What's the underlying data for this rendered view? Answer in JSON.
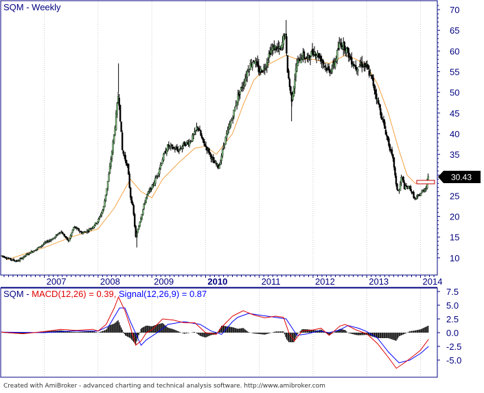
{
  "chart_data": [
    {
      "type": "candlestick",
      "title": "SQM - Weekly",
      "last_price_label": "30.43",
      "ylim": [
        6,
        72
      ],
      "yticks": [
        "10",
        "15",
        "20",
        "25",
        "30",
        "35",
        "40",
        "45",
        "50",
        "55",
        "60",
        "65",
        "70"
      ],
      "xticks": [
        {
          "label": "2007",
          "t": 2007.0,
          "bold": false
        },
        {
          "label": "2008",
          "t": 2008.0,
          "bold": false
        },
        {
          "label": "2009",
          "t": 2009.0,
          "bold": false
        },
        {
          "label": "2010",
          "t": 2010.0,
          "bold": true
        },
        {
          "label": "2011",
          "t": 2011.0,
          "bold": false
        },
        {
          "label": "2012",
          "t": 2012.0,
          "bold": false
        },
        {
          "label": "2013",
          "t": 2013.0,
          "bold": false
        },
        {
          "label": "2014",
          "t": 2014.0,
          "bold": false
        }
      ],
      "xlim": [
        2006.2,
        2014.3
      ],
      "price_path": [
        [
          2006.2,
          10.5
        ],
        [
          2006.4,
          9.5
        ],
        [
          2006.5,
          9.2
        ],
        [
          2006.7,
          11
        ],
        [
          2006.9,
          12.5
        ],
        [
          2007.0,
          13.5
        ],
        [
          2007.2,
          15
        ],
        [
          2007.3,
          16.5
        ],
        [
          2007.45,
          14
        ],
        [
          2007.55,
          17.5
        ],
        [
          2007.7,
          16
        ],
        [
          2007.8,
          16.5
        ],
        [
          2007.9,
          17.5
        ],
        [
          2008.0,
          19
        ],
        [
          2008.1,
          22
        ],
        [
          2008.2,
          30
        ],
        [
          2008.3,
          40
        ],
        [
          2008.38,
          50
        ],
        [
          2008.45,
          36
        ],
        [
          2008.55,
          32
        ],
        [
          2008.6,
          25
        ],
        [
          2008.65,
          22
        ],
        [
          2008.7,
          15
        ],
        [
          2008.8,
          20
        ],
        [
          2008.9,
          25
        ],
        [
          2009.0,
          27
        ],
        [
          2009.1,
          30
        ],
        [
          2009.2,
          34
        ],
        [
          2009.3,
          37
        ],
        [
          2009.5,
          36
        ],
        [
          2009.6,
          37.5
        ],
        [
          2009.7,
          38
        ],
        [
          2009.8,
          40
        ],
        [
          2009.85,
          42
        ],
        [
          2009.95,
          38
        ],
        [
          2010.05,
          36
        ],
        [
          2010.15,
          33
        ],
        [
          2010.25,
          32
        ],
        [
          2010.35,
          38
        ],
        [
          2010.5,
          44
        ],
        [
          2010.6,
          49
        ],
        [
          2010.7,
          52
        ],
        [
          2010.8,
          56
        ],
        [
          2010.9,
          58
        ],
        [
          2011.0,
          55
        ],
        [
          2011.1,
          56
        ],
        [
          2011.2,
          60
        ],
        [
          2011.3,
          61
        ],
        [
          2011.4,
          60
        ],
        [
          2011.48,
          65
        ],
        [
          2011.52,
          56
        ],
        [
          2011.6,
          48
        ],
        [
          2011.7,
          57
        ],
        [
          2011.8,
          59
        ],
        [
          2011.9,
          58
        ],
        [
          2012.0,
          60
        ],
        [
          2012.1,
          59
        ],
        [
          2012.2,
          57
        ],
        [
          2012.3,
          55
        ],
        [
          2012.4,
          57
        ],
        [
          2012.5,
          62
        ],
        [
          2012.6,
          61
        ],
        [
          2012.7,
          58
        ],
        [
          2012.8,
          56
        ],
        [
          2012.9,
          57
        ],
        [
          2013.0,
          56
        ],
        [
          2013.1,
          53
        ],
        [
          2013.2,
          48
        ],
        [
          2013.3,
          43
        ],
        [
          2013.4,
          38
        ],
        [
          2013.5,
          33
        ],
        [
          2013.55,
          27
        ],
        [
          2013.6,
          26
        ],
        [
          2013.65,
          30
        ],
        [
          2013.7,
          27
        ],
        [
          2013.8,
          27
        ],
        [
          2013.9,
          24
        ],
        [
          2014.0,
          25.5
        ],
        [
          2014.1,
          27
        ],
        [
          2014.15,
          30.43
        ]
      ],
      "ma_path": [
        [
          2006.3,
          9.5
        ],
        [
          2007.0,
          12.5
        ],
        [
          2007.5,
          15
        ],
        [
          2008.0,
          17
        ],
        [
          2008.3,
          22
        ],
        [
          2008.6,
          29
        ],
        [
          2008.8,
          26
        ],
        [
          2009.0,
          24.5
        ],
        [
          2009.2,
          29
        ],
        [
          2009.5,
          33
        ],
        [
          2009.8,
          36.5
        ],
        [
          2010.0,
          37
        ],
        [
          2010.2,
          35
        ],
        [
          2010.5,
          40
        ],
        [
          2010.7,
          47
        ],
        [
          2010.9,
          53
        ],
        [
          2011.2,
          57
        ],
        [
          2011.5,
          59
        ],
        [
          2011.7,
          58
        ],
        [
          2012.0,
          58
        ],
        [
          2012.3,
          57
        ],
        [
          2012.6,
          59
        ],
        [
          2012.8,
          58
        ],
        [
          2013.0,
          56.5
        ],
        [
          2013.2,
          52
        ],
        [
          2013.4,
          45
        ],
        [
          2013.6,
          36
        ],
        [
          2013.75,
          30
        ],
        [
          2013.9,
          28
        ],
        [
          2014.1,
          28
        ],
        [
          2014.2,
          28.5
        ]
      ]
    },
    {
      "type": "macd",
      "title_prefix": "SQM - ",
      "macd_label": "MACD(12,26) = 0.39, ",
      "signal_label": "Signal(12,26,9) = 0.87",
      "ylim": [
        -8,
        8
      ],
      "yticks": [
        "7.5",
        "5.0",
        "2.5",
        "0.0",
        "-2.5",
        "-5.0"
      ],
      "macd_path": [
        [
          2006.2,
          0.1
        ],
        [
          2006.6,
          -0.2
        ],
        [
          2007.0,
          0.2
        ],
        [
          2007.3,
          0.6
        ],
        [
          2007.6,
          0.4
        ],
        [
          2007.9,
          0.6
        ],
        [
          2008.0,
          0.3
        ],
        [
          2008.15,
          1.5
        ],
        [
          2008.3,
          4.5
        ],
        [
          2008.38,
          6.5
        ],
        [
          2008.5,
          4
        ],
        [
          2008.6,
          1
        ],
        [
          2008.7,
          -2.3
        ],
        [
          2008.8,
          -1.5
        ],
        [
          2008.9,
          0
        ],
        [
          2009.0,
          0.5
        ],
        [
          2009.2,
          2.5
        ],
        [
          2009.4,
          2.3
        ],
        [
          2009.6,
          1.8
        ],
        [
          2009.8,
          1.8
        ],
        [
          2010.0,
          0
        ],
        [
          2010.2,
          -0.3
        ],
        [
          2010.3,
          1
        ],
        [
          2010.5,
          3
        ],
        [
          2010.6,
          3.5
        ],
        [
          2010.7,
          4
        ],
        [
          2010.9,
          3.2
        ],
        [
          2011.1,
          2.7
        ],
        [
          2011.3,
          3
        ],
        [
          2011.45,
          2.8
        ],
        [
          2011.55,
          0
        ],
        [
          2011.65,
          -1.5
        ],
        [
          2011.8,
          0.3
        ],
        [
          2012.0,
          0.5
        ],
        [
          2012.15,
          0.8
        ],
        [
          2012.3,
          -0.5
        ],
        [
          2012.5,
          1.2
        ],
        [
          2012.6,
          1.5
        ],
        [
          2012.8,
          0.5
        ],
        [
          2013.0,
          -0.2
        ],
        [
          2013.2,
          -2
        ],
        [
          2013.4,
          -4.5
        ],
        [
          2013.55,
          -6.5
        ],
        [
          2013.7,
          -5.5
        ],
        [
          2013.9,
          -4
        ],
        [
          2014.0,
          -3.2
        ],
        [
          2014.15,
          -1.2
        ]
      ],
      "signal_path": [
        [
          2006.2,
          0.1
        ],
        [
          2007.0,
          0
        ],
        [
          2007.5,
          0.3
        ],
        [
          2008.0,
          0.3
        ],
        [
          2008.2,
          1.2
        ],
        [
          2008.4,
          4.5
        ],
        [
          2008.5,
          4.5
        ],
        [
          2008.6,
          2
        ],
        [
          2008.8,
          -2.3
        ],
        [
          2008.9,
          -1.3
        ],
        [
          2009.1,
          0
        ],
        [
          2009.3,
          1.5
        ],
        [
          2009.6,
          2
        ],
        [
          2009.9,
          1.5
        ],
        [
          2010.1,
          0.3
        ],
        [
          2010.3,
          -0.3
        ],
        [
          2010.5,
          2
        ],
        [
          2010.6,
          2.8
        ],
        [
          2010.8,
          3.5
        ],
        [
          2011.0,
          3.2
        ],
        [
          2011.3,
          2.8
        ],
        [
          2011.5,
          2.5
        ],
        [
          2011.6,
          1
        ],
        [
          2011.7,
          -0.5
        ],
        [
          2011.9,
          -0.2
        ],
        [
          2012.1,
          0.3
        ],
        [
          2012.3,
          0
        ],
        [
          2012.5,
          0.5
        ],
        [
          2012.65,
          1.3
        ],
        [
          2012.85,
          0.8
        ],
        [
          2013.0,
          0.2
        ],
        [
          2013.2,
          -1
        ],
        [
          2013.4,
          -3.5
        ],
        [
          2013.6,
          -5.5
        ],
        [
          2013.8,
          -5
        ],
        [
          2014.0,
          -3.8
        ],
        [
          2014.15,
          -2.5
        ]
      ]
    }
  ],
  "footer": "Created with AmiBroker - advanced charting and technical analysis software. http://www.amibroker.com",
  "colors": {
    "border": "#000080",
    "axis_text": "#000080",
    "title_price": "#000080",
    "macd": "#e00000",
    "signal": "#0000ff",
    "histogram": "#000000",
    "ma": "#f4a040",
    "candle_up": "#7cc07c",
    "candle_down": "#000000",
    "price_box": "#000000"
  }
}
